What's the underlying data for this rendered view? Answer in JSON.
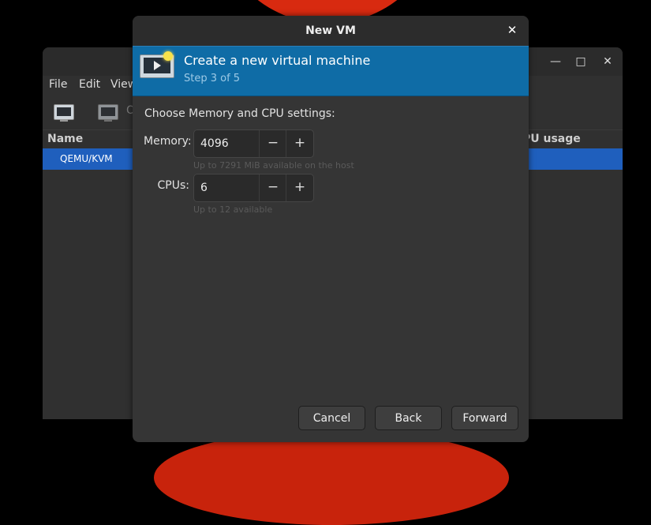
{
  "background_window": {
    "menu": [
      "File",
      "Edit",
      "View"
    ],
    "toolbar_open_label": "O",
    "columns": {
      "name": "Name",
      "cpu_usage": "PU usage"
    },
    "rows": [
      "QEMU/KVM"
    ],
    "controls": {
      "minimize": "—",
      "maximize": "□",
      "close": "✕"
    }
  },
  "dialog": {
    "title": "New VM",
    "close_glyph": "✕",
    "banner": {
      "title": "Create a new virtual machine",
      "step": "Step 3 of 5"
    },
    "prompt": "Choose Memory and CPU settings:",
    "memory": {
      "label": "Memory:",
      "value": "4096",
      "hint": "Up to 7291 MiB available on the host"
    },
    "cpus": {
      "label": "CPUs:",
      "value": "6",
      "hint": "Up to 12 available"
    },
    "spin_minus": "−",
    "spin_plus": "+",
    "buttons": {
      "cancel": "Cancel",
      "back": "Back",
      "forward": "Forward"
    }
  },
  "colors": {
    "banner": "#0f6ca6",
    "selection": "#1f5fbd",
    "sun": "#d82a10"
  },
  "icons": [
    "new-vm-icon",
    "monitor-icon",
    "close-icon",
    "minimize-icon",
    "maximize-icon",
    "minus-icon",
    "plus-icon"
  ]
}
